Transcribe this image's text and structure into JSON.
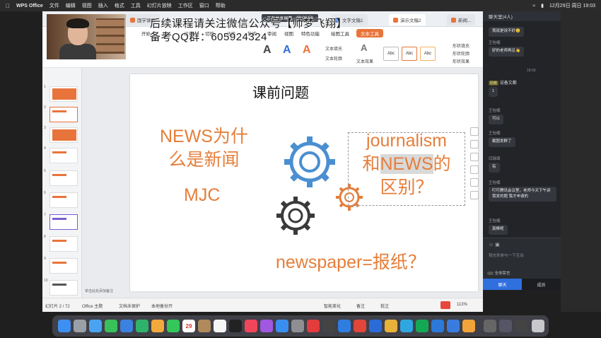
{
  "menubar": {
    "app_name": "WPS Office",
    "items": [
      "文件",
      "编辑",
      "视图",
      "插入",
      "格式",
      "工具",
      "幻灯片放映",
      "工作区",
      "窗口",
      "帮助"
    ],
    "clock": "12月29日 周日 19:03"
  },
  "overlay": {
    "watermark_line1": "后续课程请关注微信公众号【师梦飞翔】",
    "watermark_line2": "备考QQ群：605924324",
    "float_label": "正在共享屏幕",
    "float_time": "00:06:58"
  },
  "wps": {
    "tabs": [
      {
        "label": "国学课程"
      },
      {
        "label": "文字文稿1"
      },
      {
        "label": "演示文稿2"
      },
      {
        "label": "新闻..."
      }
    ],
    "ribbon_tabs": [
      "开始",
      "插入",
      "设计",
      "切换",
      "动画",
      "放映",
      "审阅",
      "视图",
      "特色功能",
      "绘图工具",
      "文本工具"
    ],
    "ribbon": {
      "text_fill": "文本填充",
      "text_outline": "文本轮廓",
      "text_effect": "文本效果",
      "shape_fill": "形状填充",
      "shape_outline": "形状轮廓",
      "shape_effect": "形状效果",
      "style_label": "Abc"
    },
    "slide_numbers": [
      "1",
      "2",
      "3",
      "4",
      "5",
      "6",
      "7",
      "8",
      "9",
      "10"
    ],
    "notes_placeholder": "单击此处添加备注",
    "status": {
      "slide_counter": "幻灯片 2 / 72",
      "theme": "Office 主题",
      "doc_status": "文档未保护",
      "save_status": "本地备份开",
      "beautify": "智能美化",
      "notes_btn": "备注",
      "comments_btn": "批注",
      "zoom": "113%"
    }
  },
  "slide": {
    "title": "课前问题",
    "left_line1": "NEWS为什",
    "left_line2": "么是新闻",
    "mjc": "MJC",
    "right_line1": "journalism",
    "right_line2a": "和",
    "right_line2b": "NEWS",
    "right_line2c": "的",
    "right_line3": "区别？",
    "bottom": "newspaper=报纸？",
    "colors": {
      "accent": "#e67e3a",
      "gear_blue": "#4a8fd1",
      "gear_dark": "#3a3a3a"
    }
  },
  "chat": {
    "title": "聊天室(4人)",
    "messages": [
      {
        "who": "",
        "text": "我就是说不好😊"
      },
      {
        "who": "王怡楠",
        "text": "好的老师再见👋"
      },
      {
        "who": "助教",
        "text": "设备文都",
        "tagged": true
      },
      {
        "who": "",
        "text": "1"
      },
      {
        "who": "王怡楠",
        "text": "可以"
      },
      {
        "who": "王怡楠",
        "text": "截图发群了"
      },
      {
        "who": "闫瑞琦",
        "text": "有"
      },
      {
        "who": "王怡楠",
        "text": "叮叮腾讯会议里，老师今天下午讲我发的题 我才申请的"
      },
      {
        "who": "王怡楠",
        "text": "真棒呢"
      }
    ],
    "time": "18:59",
    "input_placeholder": "我也来参与一下互动",
    "mute_all": "全体禁言",
    "tab_chat": "聊天",
    "tab_members": "成员"
  },
  "dock": {
    "calendar_day": "29"
  }
}
